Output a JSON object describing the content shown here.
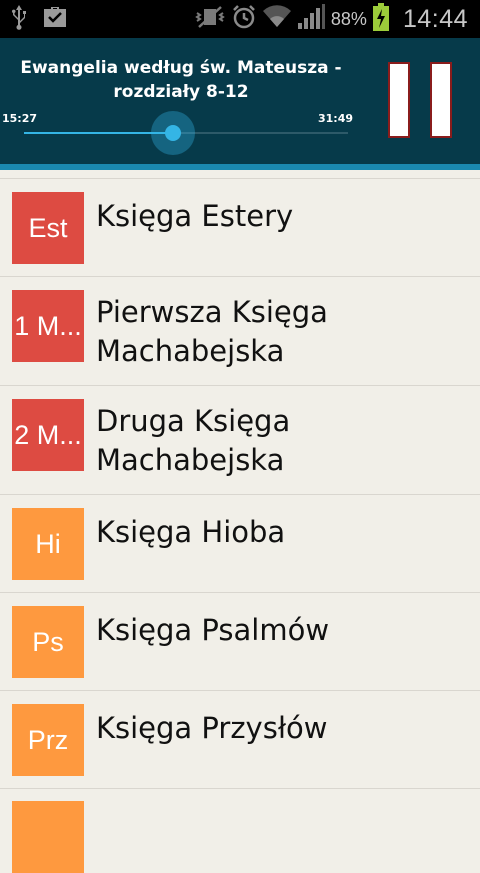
{
  "statusbar": {
    "battery_percent": "88%",
    "time": "14:44",
    "icons_left": [
      "usb-icon",
      "briefcase-check-icon"
    ],
    "icons_right": [
      "vibrate-icon",
      "alarm-icon",
      "wifi-icon",
      "signal-icon",
      "battery-charging-icon"
    ]
  },
  "player": {
    "title": "Ewangelia według św. Mateusza - rozdziały 8-12",
    "elapsed": "15:27",
    "total": "31:49",
    "progress_fraction": 0.46,
    "pause_icon": "pause-icon",
    "colors": {
      "background": "#063a4a",
      "accent": "#34b5e5",
      "bottom_bar": "#1a89b0"
    }
  },
  "books": [
    {
      "abbr": "Est",
      "title": "Księga Estery",
      "color": "#dd4b42"
    },
    {
      "abbr": "1 M...",
      "title": "Pierwsza Księga Machabejska",
      "color": "#dd4b42"
    },
    {
      "abbr": "2 M...",
      "title": "Druga Księga Machabejska",
      "color": "#dd4b42"
    },
    {
      "abbr": "Hi",
      "title": "Księga Hioba",
      "color": "#fe993f"
    },
    {
      "abbr": "Ps",
      "title": "Księga Psalmów",
      "color": "#fe993f"
    },
    {
      "abbr": "Prz",
      "title": "Księga Przysłów",
      "color": "#fe993f"
    },
    {
      "abbr": "",
      "title": "",
      "color": "#fe993f"
    }
  ]
}
